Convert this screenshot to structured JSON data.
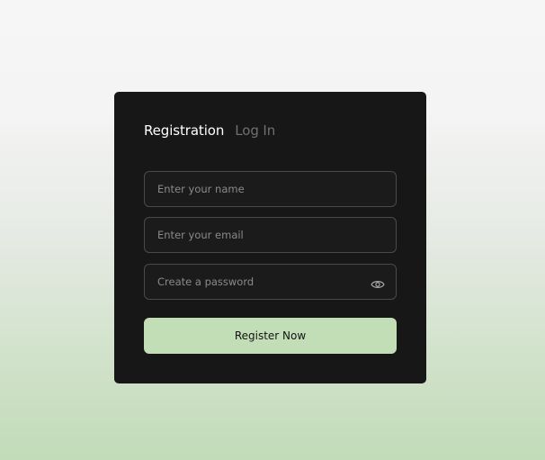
{
  "tabs": {
    "registration": "Registration",
    "login": "Log In"
  },
  "form": {
    "name_placeholder": "Enter your name",
    "email_placeholder": "Enter your email",
    "password_placeholder": "Create a password",
    "password_toggle_icon": "eye-icon",
    "submit_label": "Register Now"
  },
  "colors": {
    "card_background": "#171717",
    "accent_button": "#c2deb6",
    "active_tab": "#ffffff",
    "inactive_tab": "#707070"
  }
}
